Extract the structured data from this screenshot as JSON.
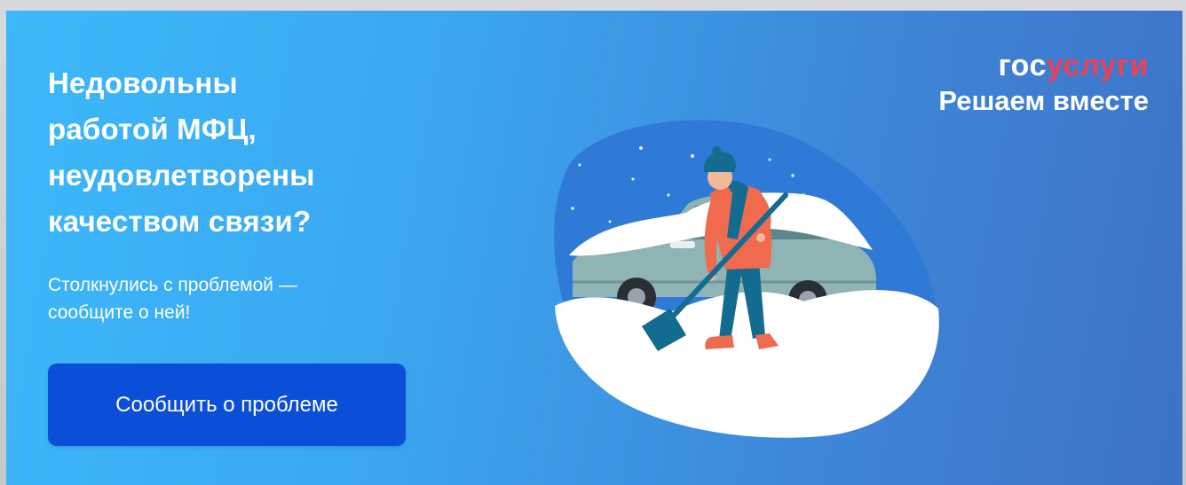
{
  "banner": {
    "headline_lines": [
      "Недовольны",
      "работой МФЦ,",
      "неудовлетворены",
      "качеством связи?"
    ],
    "subtext_lines": [
      "Столкнулись с проблемой —",
      "сообщите о ней!"
    ],
    "cta_label": "Сообщить о проблеме",
    "illustration_icon": "person-shoveling-snow-near-car"
  },
  "brand": {
    "logo_part1": "гос",
    "logo_part2": "услуги",
    "tagline": "Решаем вместе"
  },
  "colors": {
    "background_start": "#3db8fb",
    "background_end": "#3d73c7",
    "button": "#0b4fd8",
    "logo_accent": "#ee3f58",
    "text": "#ffffff"
  }
}
